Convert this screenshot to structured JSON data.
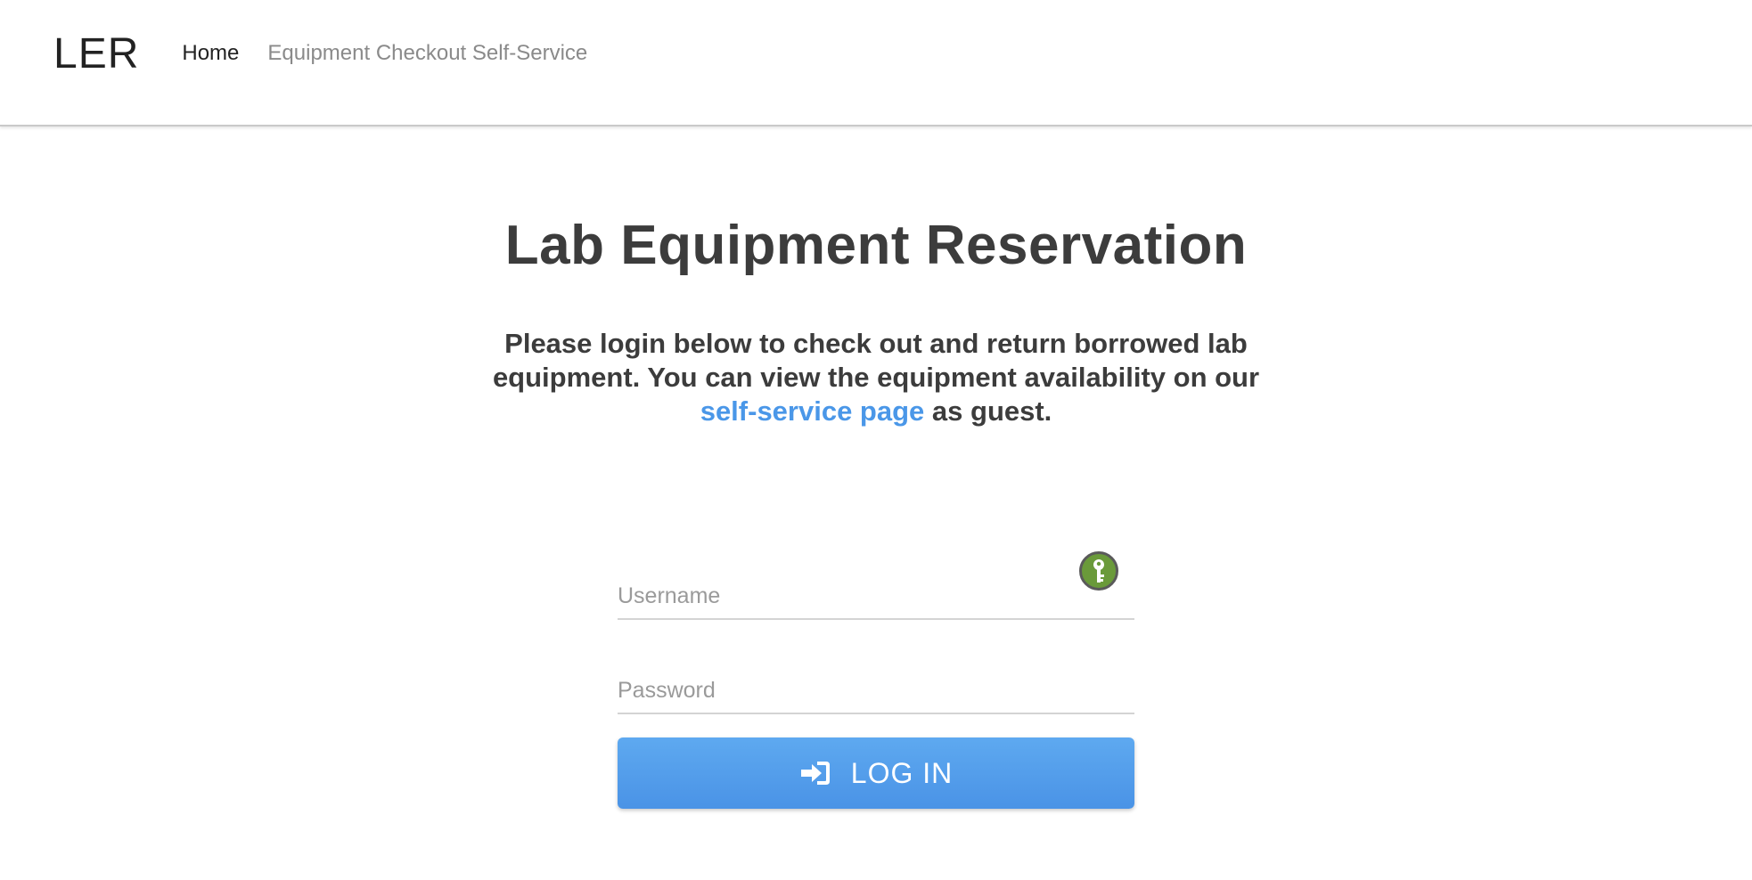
{
  "navbar": {
    "brand": "LER",
    "links": [
      {
        "label": "Home"
      },
      {
        "label": "Equipment Checkout Self-Service"
      }
    ]
  },
  "main": {
    "title": "Lab Equipment Reservation",
    "intro_before_link": "Please login below to check out and return borrowed lab equipment. You can view the equipment availability on our ",
    "intro_link": "self-service page",
    "intro_after_link": " as guest."
  },
  "login": {
    "username_placeholder": "Username",
    "password_placeholder": "Password",
    "username_value": "",
    "password_value": "",
    "submit_label": "LOG IN",
    "submit_icon": "sign-in-icon",
    "password_manager_icon": "keepass-key-icon"
  },
  "colors": {
    "accent": "#4a97e8",
    "button_top": "#5ea9f0",
    "button_bottom": "#4a93e6",
    "key_badge_green": "#6a9a3a"
  }
}
